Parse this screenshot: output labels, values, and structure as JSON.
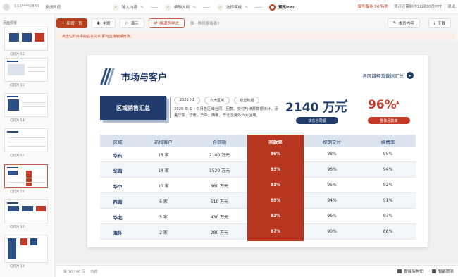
{
  "topbar": {
    "user": "133****2880",
    "feedback": "反馈问题",
    "steps": [
      {
        "label": "输入内容",
        "state": "done"
      },
      {
        "label": "编辑大纲",
        "state": "done"
      },
      {
        "label": "选择模板",
        "state": "done"
      },
      {
        "label": "预览PPT",
        "state": "current"
      }
    ],
    "vip": "填写备券 50 特购",
    "eta": "预计还需制作16段20页PPT",
    "exit": "退出"
  },
  "toolbar": {
    "new_page": "新增一页",
    "theme": "主题",
    "present": "演示",
    "replace_style": "换课页样式",
    "style_hint": "换一种风格看看?",
    "this_page_content": "本页内容",
    "download": "下载"
  },
  "hint": "点击幻灯片中的任意文字,即可直接编辑修改。",
  "sidebar": {
    "title": "页面预览",
    "thumbs": [
      {
        "label": "幻灯片 12"
      },
      {
        "label": "幻灯片 13"
      },
      {
        "label": "幻灯片 14"
      },
      {
        "label": "幻灯片 15"
      },
      {
        "label": "幻灯片 16"
      },
      {
        "label": "幻灯片 17"
      },
      {
        "label": "幻灯片 18"
      }
    ]
  },
  "slide": {
    "title": "市场与客户",
    "region_link": "各区域经营数据汇总",
    "summary_box": "区域销售汇总",
    "tags": [
      "2026 H1",
      "六大区域",
      "经营数据"
    ],
    "description": "2026 年 1 – 6 月各区域合同、回款、交付与续费数据统计。涵盖华东、华南、华中、西南、华北及海外六大区域。",
    "kpi_amount": "2140 万元",
    "kpi_amount_label": "华东合同额",
    "kpi_rate": "96%",
    "kpi_rate_label": "整体回款率",
    "table": {
      "headers": [
        "区域",
        "新增客户",
        "合同额",
        "回款率",
        "按期交付",
        "续费率"
      ],
      "rows": [
        [
          "华东",
          "18 家",
          "2140 万元",
          "96%",
          "98%",
          "95%"
        ],
        [
          "华南",
          "14 家",
          "1520 万元",
          "93%",
          "96%",
          "94%"
        ],
        [
          "华中",
          "10 家",
          "860 万元",
          "91%",
          "95%",
          "92%"
        ],
        [
          "西南",
          "6 家",
          "510 万元",
          "89%",
          "94%",
          "91%"
        ],
        [
          "华北",
          "5 家",
          "430 万元",
          "92%",
          "96%",
          "93%"
        ],
        [
          "海外",
          "2 家",
          "280 万元",
          "87%",
          "90%",
          "88%"
        ]
      ]
    }
  },
  "footer": {
    "pager": "第 16 / 40 页",
    "content": "内容",
    "smart_diagram": "智能架构图",
    "smart_chart": "智能图表"
  },
  "colors": {
    "accent": "#b7411e",
    "navy": "#1f3c6b",
    "red_column": "#b6361f"
  }
}
